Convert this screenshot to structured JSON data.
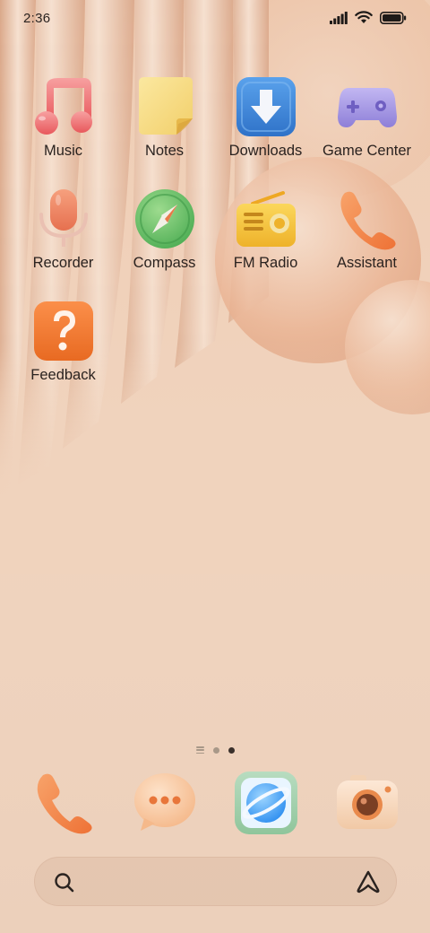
{
  "status_bar": {
    "time": "2:36",
    "signal_icon": "signal-bars-icon",
    "wifi_icon": "wifi-icon",
    "battery_icon": "battery-full-icon"
  },
  "apps": [
    {
      "label": "Music",
      "icon": "music-note-icon"
    },
    {
      "label": "Notes",
      "icon": "sticky-note-icon"
    },
    {
      "label": "Downloads",
      "icon": "download-arrow-icon"
    },
    {
      "label": "Game Center",
      "icon": "gamepad-icon"
    },
    {
      "label": "Recorder",
      "icon": "microphone-icon"
    },
    {
      "label": "Compass",
      "icon": "compass-icon"
    },
    {
      "label": "FM Radio",
      "icon": "radio-icon"
    },
    {
      "label": "Assistant",
      "icon": "phone-handset-icon"
    },
    {
      "label": "Feedback",
      "icon": "question-mark-icon"
    }
  ],
  "page_indicator": {
    "pages": 2,
    "current": 2
  },
  "dock": [
    {
      "icon": "phone-icon"
    },
    {
      "icon": "messages-icon"
    },
    {
      "icon": "browser-planet-icon"
    },
    {
      "icon": "camera-icon"
    }
  ],
  "search": {
    "search_icon": "search-icon",
    "assistant_icon": "assistant-logo-icon"
  },
  "colors": {
    "wallpaper": "#f0d3bd",
    "label_text": "#2a221f",
    "accent_orange": "#f08a4b"
  }
}
